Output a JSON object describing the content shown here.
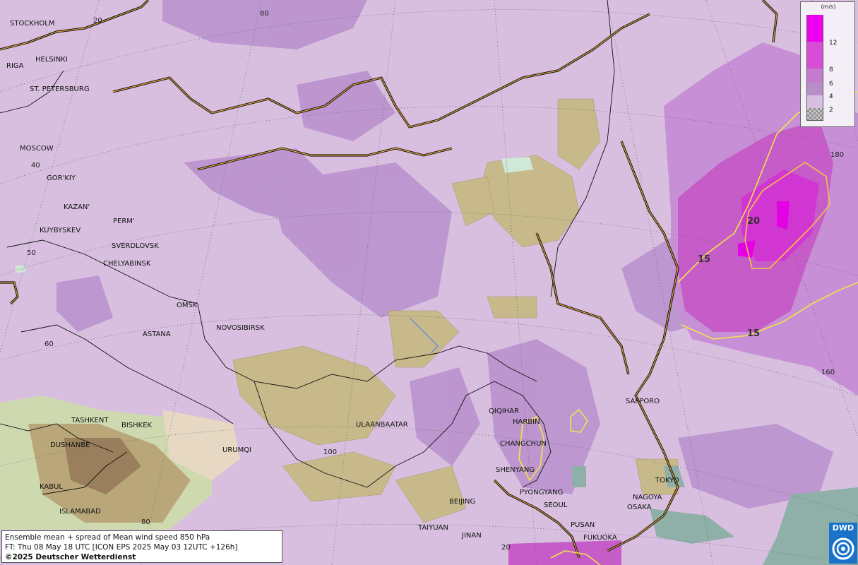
{
  "cities": [
    {
      "name": "STOCKHOLM"
    },
    {
      "name": "HELSINKI"
    },
    {
      "name": "RIGA"
    },
    {
      "name": "ST. PETERSBURG"
    },
    {
      "name": "MOSCOW"
    },
    {
      "name": "GOR'KIY"
    },
    {
      "name": "KAZAN'"
    },
    {
      "name": "PERM'"
    },
    {
      "name": "KUYBYSKEV"
    },
    {
      "name": "SVERDLOVSK"
    },
    {
      "name": "CHELYABINSK"
    },
    {
      "name": "OMSK"
    },
    {
      "name": "NOVOSIBIRSK"
    },
    {
      "name": "ASTANA"
    },
    {
      "name": "TASHKENT"
    },
    {
      "name": "BISHKEK"
    },
    {
      "name": "DUSHANBE"
    },
    {
      "name": "URUMQI"
    },
    {
      "name": "ULAANBAATAR"
    },
    {
      "name": "KABUL"
    },
    {
      "name": "ISLAMABAD"
    },
    {
      "name": "QIQIHAR"
    },
    {
      "name": "HARBIN"
    },
    {
      "name": "CHANGCHUN"
    },
    {
      "name": "SHENYANG"
    },
    {
      "name": "PYONGYANG"
    },
    {
      "name": "SEOUL"
    },
    {
      "name": "BEIJING"
    },
    {
      "name": "TAIYUAN"
    },
    {
      "name": "JINAN"
    },
    {
      "name": "PUSAN"
    },
    {
      "name": "FUKUOKA"
    },
    {
      "name": "SAPPORO"
    },
    {
      "name": "TOKYO"
    },
    {
      "name": "NAGOYA"
    },
    {
      "name": "OSAKA"
    }
  ],
  "grid_labels": [
    "20",
    "80",
    "40",
    "50",
    "60",
    "100",
    "80",
    "20",
    "180",
    "160"
  ],
  "contours": [
    "20",
    "15",
    "15"
  ],
  "legend": {
    "unit": "(m/s)",
    "items": [
      {
        "label": "12",
        "color": "#ee00ee"
      },
      {
        "label": "8",
        "color": "#d84dd8"
      },
      {
        "label": "6",
        "color": "#c37ccd"
      },
      {
        "label": "4",
        "color": "#b78fc8"
      },
      {
        "label": "2",
        "color": "#d6bfe0"
      },
      {
        "label": "",
        "color": "#b0b0b0"
      }
    ]
  },
  "info": {
    "line1": "Ensemble mean + spread of Mean wind speed 850 hPa",
    "line2": "FT: Thu 08 May 18 UTC [ICON EPS 2025 May 03 12UTC +126h]",
    "line3": "©2025 Deutscher Wetterdienst"
  },
  "logo": {
    "text": "DWD",
    "color": "#1a73c9"
  },
  "colors": {
    "base": "#d8bfe0",
    "spread_high": "#b87ccb",
    "terrain": "#c8b98a",
    "coast": "#e3a23a",
    "contour": "#f3e24a"
  }
}
